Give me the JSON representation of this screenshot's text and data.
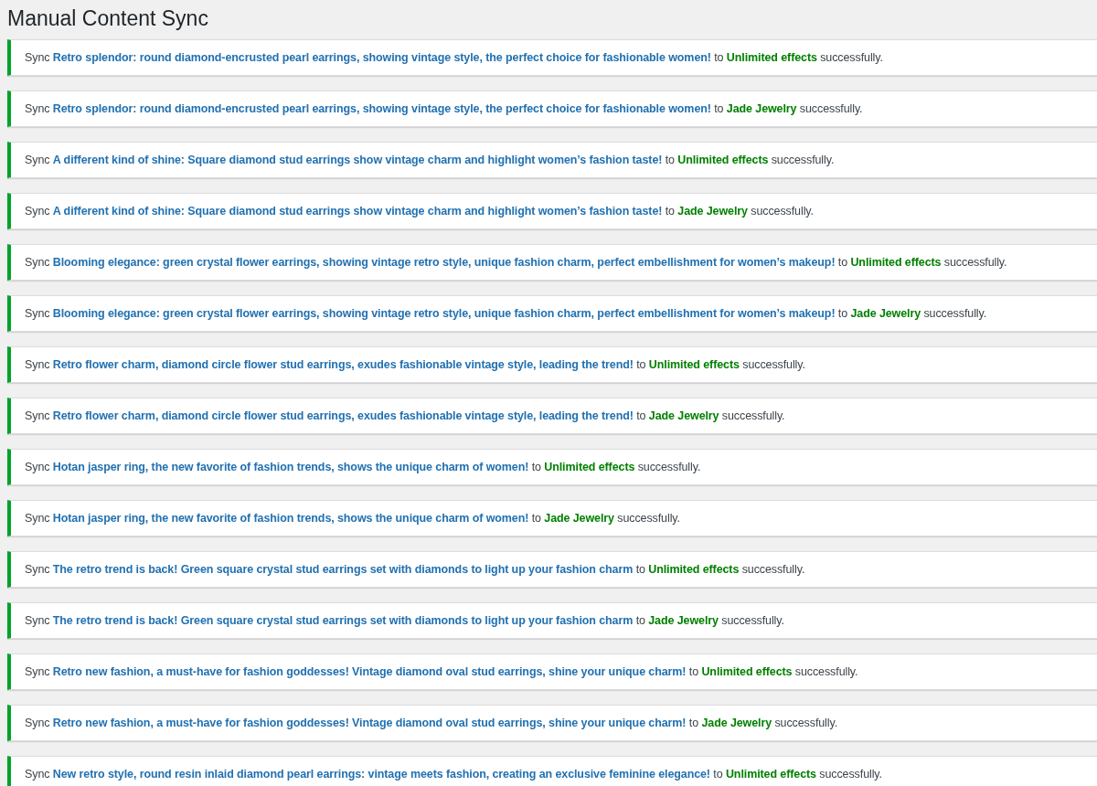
{
  "page_title": "Manual Content Sync",
  "notices": [
    {
      "prefix": "Sync",
      "product": "Retro splendor: round diamond-encrusted pearl earrings, showing vintage style, the perfect choice for fashionable women!",
      "connector": "to",
      "site": "Unlimited effects",
      "suffix": "successfully."
    },
    {
      "prefix": "Sync",
      "product": "Retro splendor: round diamond-encrusted pearl earrings, showing vintage style, the perfect choice for fashionable women!",
      "connector": "to",
      "site": "Jade Jewelry",
      "suffix": "successfully."
    },
    {
      "prefix": "Sync",
      "product": "A different kind of shine: Square diamond stud earrings show vintage charm and highlight women’s fashion taste!",
      "connector": "to",
      "site": "Unlimited effects",
      "suffix": "successfully."
    },
    {
      "prefix": "Sync",
      "product": "A different kind of shine: Square diamond stud earrings show vintage charm and highlight women’s fashion taste!",
      "connector": "to",
      "site": "Jade Jewelry",
      "suffix": "successfully."
    },
    {
      "prefix": "Sync",
      "product": "Blooming elegance: green crystal flower earrings, showing vintage retro style, unique fashion charm, perfect embellishment for women’s makeup!",
      "connector": "to",
      "site": "Unlimited effects",
      "suffix": "successfully."
    },
    {
      "prefix": "Sync",
      "product": "Blooming elegance: green crystal flower earrings, showing vintage retro style, unique fashion charm, perfect embellishment for women’s makeup!",
      "connector": "to",
      "site": "Jade Jewelry",
      "suffix": "successfully."
    },
    {
      "prefix": "Sync",
      "product": "Retro flower charm, diamond circle flower stud earrings, exudes fashionable vintage style, leading the trend!",
      "connector": "to",
      "site": "Unlimited effects",
      "suffix": "successfully."
    },
    {
      "prefix": "Sync",
      "product": "Retro flower charm, diamond circle flower stud earrings, exudes fashionable vintage style, leading the trend!",
      "connector": "to",
      "site": "Jade Jewelry",
      "suffix": "successfully."
    },
    {
      "prefix": "Sync",
      "product": "Hotan jasper ring, the new favorite of fashion trends, shows the unique charm of women!",
      "connector": "to",
      "site": "Unlimited effects",
      "suffix": "successfully."
    },
    {
      "prefix": "Sync",
      "product": "Hotan jasper ring, the new favorite of fashion trends, shows the unique charm of women!",
      "connector": "to",
      "site": "Jade Jewelry",
      "suffix": "successfully."
    },
    {
      "prefix": "Sync",
      "product": "The retro trend is back! Green square crystal stud earrings set with diamonds to light up your fashion charm",
      "connector": "to",
      "site": "Unlimited effects",
      "suffix": "successfully."
    },
    {
      "prefix": "Sync",
      "product": "The retro trend is back! Green square crystal stud earrings set with diamonds to light up your fashion charm",
      "connector": "to",
      "site": "Jade Jewelry",
      "suffix": "successfully."
    },
    {
      "prefix": "Sync",
      "product": "Retro new fashion, a must-have for fashion goddesses! Vintage diamond oval stud earrings, shine your unique charm!",
      "connector": "to",
      "site": "Unlimited effects",
      "suffix": "successfully."
    },
    {
      "prefix": "Sync",
      "product": "Retro new fashion, a must-have for fashion goddesses! Vintage diamond oval stud earrings, shine your unique charm!",
      "connector": "to",
      "site": "Jade Jewelry",
      "suffix": "successfully."
    },
    {
      "prefix": "Sync",
      "product": "New retro style, round resin inlaid diamond pearl earrings: vintage meets fashion, creating an exclusive feminine elegance!",
      "connector": "to",
      "site": "Unlimited effects",
      "suffix": "successfully."
    }
  ]
}
